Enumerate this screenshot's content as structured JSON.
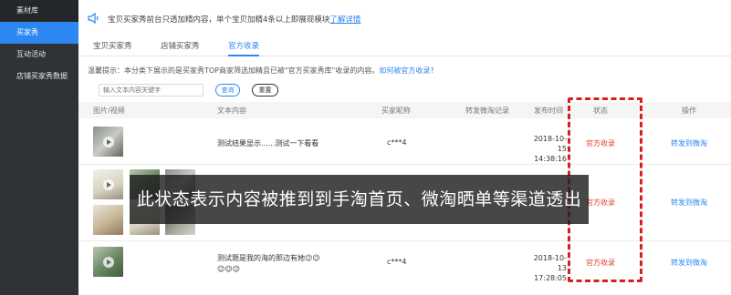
{
  "sidebar": {
    "items": [
      {
        "label": "素材库"
      },
      {
        "label": "买家秀"
      },
      {
        "label": "互动活动"
      },
      {
        "label": "店铺买家秀数据"
      }
    ]
  },
  "notice": {
    "text": "宝贝买家秀前台只透加精内容，单个宝贝加精4条以上即展现模块",
    "link": "了解详情"
  },
  "tabs": [
    {
      "label": "宝贝买家秀"
    },
    {
      "label": "店铺买家秀"
    },
    {
      "label": "官方收录"
    }
  ],
  "tip": {
    "text": "温馨提示：本分类下展示的是买家秀TOP商家筛选加精且已被\"官方买家秀库\"收录的内容。",
    "link": "如何被官方收录?"
  },
  "search": {
    "placeholder": "输入文本内容关键字",
    "query_label": "查询",
    "reset_label": "重置"
  },
  "table": {
    "headers": [
      "图片/视频",
      "文本内容",
      "买家昵称",
      "转发微淘记录",
      "发布时间",
      "状态",
      "操作"
    ],
    "rows": [
      {
        "text": "测试结果显示......测试一下看看",
        "nick": "c***4",
        "date": "2018-10-15",
        "time": "14:38:16",
        "status": "官方收录",
        "action": "转发到微淘"
      },
      {
        "text": "",
        "nick": "",
        "date": "",
        "time": "",
        "status": "官方收录",
        "action": "转发到微淘"
      },
      {
        "text": "测试题是我的海的那边有她😉😉",
        "text2": "😉😉😉",
        "nick": "c***4",
        "date": "2018-10-13",
        "time": "17:28:05",
        "status": "官方收录",
        "action": "转发到微淘"
      }
    ]
  },
  "caption": "此状态表示内容被推到到手淘首页、微淘晒单等渠道透出",
  "colors": {
    "accent": "#2d87f0",
    "status": "#e0412b",
    "highlight": "#d61f1f",
    "sidebar": "#2f3337"
  }
}
